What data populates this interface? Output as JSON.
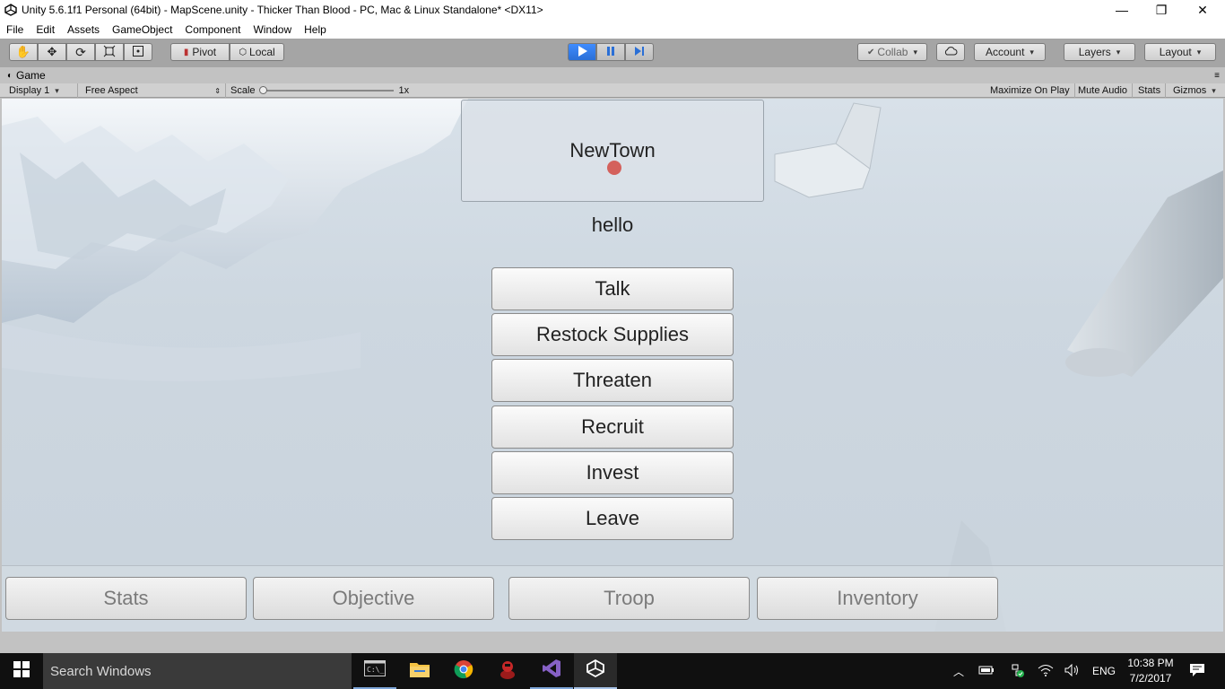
{
  "window": {
    "title": "Unity 5.6.1f1 Personal (64bit) - MapScene.unity - Thicker Than Blood - PC, Mac & Linux Standalone* <DX11>",
    "minimize": "—",
    "restore": "❐",
    "close": "✕"
  },
  "menu": [
    "File",
    "Edit",
    "Assets",
    "GameObject",
    "Component",
    "Window",
    "Help"
  ],
  "toolbar": {
    "pivot_label": "Pivot",
    "local_label": "Local",
    "collab_label": "Collab",
    "account_label": "Account",
    "layers_label": "Layers",
    "layout_label": "Layout",
    "play_state": "playing"
  },
  "game_view": {
    "tab_label": "Game",
    "display_label": "Display 1",
    "aspect_label": "Free Aspect",
    "scale_label": "Scale",
    "scale_value": "1x",
    "maximize_on_play": "Maximize On Play",
    "mute_audio": "Mute Audio",
    "stats": "Stats",
    "gizmos": "Gizmos"
  },
  "game_ui": {
    "town_name": "NewTown",
    "greeting": "hello",
    "actions": [
      "Talk",
      "Restock Supplies",
      "Threaten",
      "Recruit",
      "Invest",
      "Leave"
    ],
    "bottom_tabs": [
      "Stats",
      "Objective",
      "Troop",
      "Inventory"
    ]
  },
  "taskbar": {
    "search_placeholder": "Search Windows",
    "language": "ENG",
    "time": "10:38 PM",
    "date": "7/2/2017",
    "apps": [
      "cmd-icon",
      "file-explorer-icon",
      "chrome-icon",
      "app-red-icon",
      "visual-studio-icon",
      "unity-icon"
    ]
  },
  "colors": {
    "play_accent": "#2a6fd6",
    "toolbar_bg": "#a5a5a5",
    "taskbar_bg": "#101010"
  }
}
